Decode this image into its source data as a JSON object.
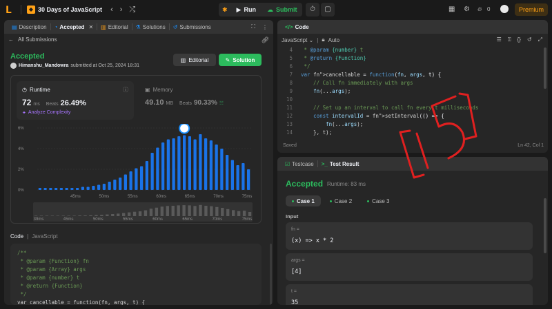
{
  "nav": {
    "list_title": "30 Days of JavaScript",
    "run_label": "Run",
    "submit_label": "Submit",
    "coins": "0",
    "premium_label": "Premium"
  },
  "left": {
    "tabs": [
      {
        "label": "Description"
      },
      {
        "label": "Accepted"
      },
      {
        "label": "Editorial"
      },
      {
        "label": "Solutions"
      },
      {
        "label": "Submissions"
      }
    ],
    "back_label": "All Submissions",
    "status": "Accepted",
    "username": "Himanshu_Mandowra",
    "submitted_text": "submitted at Oct 25, 2024 18:31",
    "editorial_btn": "Editorial",
    "solution_btn": "Solution",
    "runtime": {
      "label": "Runtime",
      "value": "72",
      "unit": "ms",
      "beats_label": "Beats",
      "beats_value": "26.49%",
      "analyze": "Analyze Complexity"
    },
    "memory": {
      "label": "Memory",
      "value": "49.10",
      "unit": "MB",
      "beats_label": "Beats",
      "beats_value": "90.33%"
    },
    "code_header": "Code",
    "code_lang": "JavaScript",
    "snippet": [
      "/**",
      " * @param {Function} fn",
      " * @param {Array} args",
      " * @param {number} t",
      " * @return {Function}",
      " */",
      "var cancellable = function(fn, args, t) {"
    ]
  },
  "chart_data": {
    "type": "bar",
    "title": "",
    "ylabel": "",
    "yticks": [
      "6%",
      "4%",
      "2%",
      "0%"
    ],
    "ylim": [
      0,
      6
    ],
    "xticks": [
      "39ms",
      "45ms",
      "50ms",
      "55ms",
      "60ms",
      "65ms",
      "70ms",
      "75ms"
    ],
    "values": [
      0.2,
      0.2,
      0.2,
      0.2,
      0.2,
      0.2,
      0.2,
      0.2,
      0.3,
      0.3,
      0.4,
      0.5,
      0.6,
      0.8,
      1.0,
      1.2,
      1.5,
      1.8,
      2.1,
      2.3,
      2.8,
      3.6,
      4.1,
      4.6,
      4.9,
      5.0,
      5.2,
      5.3,
      5.2,
      4.9,
      5.4,
      5.0,
      4.8,
      4.4,
      4.0,
      3.4,
      2.9,
      2.4,
      2.6,
      2.0
    ],
    "mini_xticks": [
      "39ms",
      "45ms",
      "50ms",
      "55ms",
      "60ms",
      "65ms",
      "70ms",
      "75ms"
    ],
    "bar_color": "#1a73e8",
    "highlight_color": "#1a90ff"
  },
  "code_panel": {
    "title": "Code",
    "language": "JavaScript",
    "mode": "Auto",
    "saved": "Saved",
    "position": "Ln 42, Col 1",
    "lines": [
      {
        "n": "4",
        "t": " * @param {number} t"
      },
      {
        "n": "5",
        "t": " * @return {Function}"
      },
      {
        "n": "6",
        "t": " */"
      },
      {
        "n": "7",
        "t": "var cancellable = function(fn, args, t) {"
      },
      {
        "n": "8",
        "t": "    // Call fn immediately with args"
      },
      {
        "n": "9",
        "t": "    fn(...args);"
      },
      {
        "n": "10",
        "t": ""
      },
      {
        "n": "11",
        "t": "    // Set up an interval to call fn every t milliseconds"
      },
      {
        "n": "12",
        "t": "    const intervalId = setInterval(() => {"
      },
      {
        "n": "13",
        "t": "        fn(...args);"
      },
      {
        "n": "14",
        "t": "    }, t);"
      },
      {
        "n": "15",
        "t": ""
      },
      {
        "n": "16",
        "t": "    // Return the cancel function that stops the interval"
      }
    ]
  },
  "result_panel": {
    "tab_testcase": "Testcase",
    "tab_result": "Test Result",
    "status": "Accepted",
    "runtime": "Runtime: 83 ms",
    "cases": [
      "Case 1",
      "Case 2",
      "Case 3"
    ],
    "input_label": "Input",
    "inputs": [
      {
        "name": "fn =",
        "value": "(x) => x * 2"
      },
      {
        "name": "args =",
        "value": "[4]"
      },
      {
        "name": "t =",
        "value": "35"
      }
    ]
  },
  "annotation": {
    "text": "[15]",
    "color": "#e02020"
  }
}
